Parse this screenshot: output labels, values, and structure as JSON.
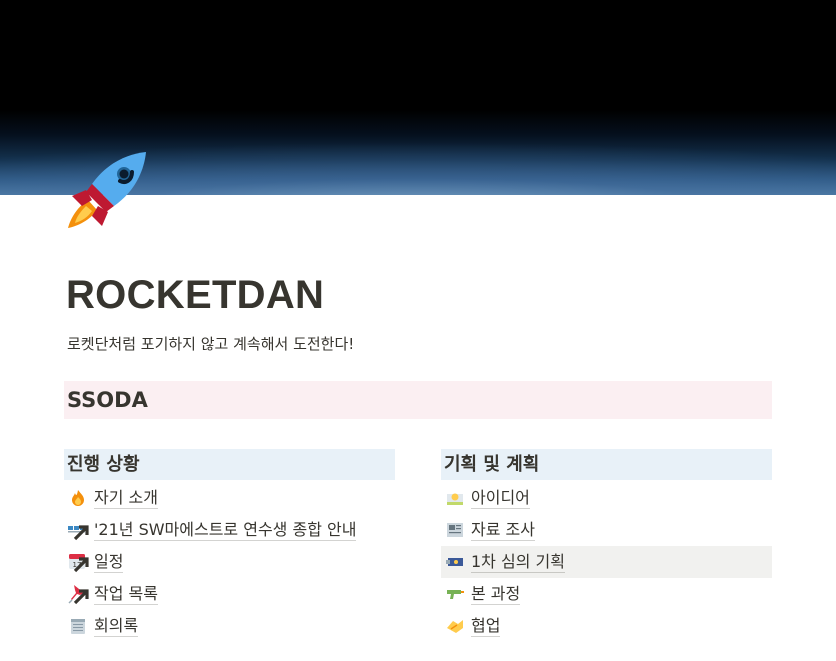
{
  "page": {
    "title": "ROCKETDAN",
    "subtitle": "로켓단처럼 포기하지 않고 계속해서 도전한다!",
    "icon": "rocket-icon"
  },
  "banner": {
    "label": "SSODA",
    "color": "#fbeff2"
  },
  "left_column": {
    "heading": "진행 상황",
    "links": [
      {
        "label": "자기 소개",
        "icon": "fire-icon"
      },
      {
        "label": "'21년 SW마에스트로 연수생 종합 안내",
        "icon": "link-blocks-icon"
      },
      {
        "label": "일정",
        "icon": "calendar-link-icon"
      },
      {
        "label": "작업 목록",
        "icon": "pushpin-link-icon"
      },
      {
        "label": "회의록",
        "icon": "spiral-notepad-icon"
      }
    ]
  },
  "right_column": {
    "heading": "기획 및 계획",
    "links": [
      {
        "label": "아이디어",
        "icon": "idea-icon"
      },
      {
        "label": "자료 조사",
        "icon": "newspaper-icon"
      },
      {
        "label": "1차 심의 기획",
        "icon": "flag-icon"
      },
      {
        "label": "본 과정",
        "icon": "water-gun-icon"
      },
      {
        "label": "협업",
        "icon": "handshake-icon"
      }
    ]
  },
  "colors": {
    "text": "#37352f",
    "column_heading_bg": "#e8f1f8",
    "hover_row_bg": "#f1f1ef"
  }
}
